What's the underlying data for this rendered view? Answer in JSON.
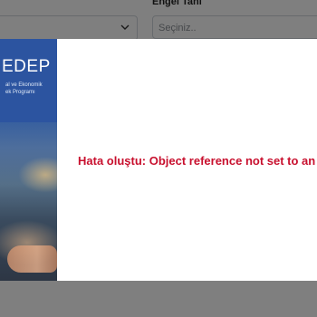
{
  "background_form": {
    "disability_label": "Engel Tanı",
    "disability_placeholder": "Seçiniz.."
  },
  "modal": {
    "sidebar": {
      "brand": "EDEP",
      "tagline_line1": "al ve Ekonomik",
      "tagline_line2": "ek Programı"
    },
    "error_message": "Hata oluştu: Object reference not set to an insta"
  },
  "colors": {
    "error_text": "#c8102e",
    "sidebar_blue": "#2c54a0",
    "overlay": "rgba(0,0,0,0.5)"
  }
}
